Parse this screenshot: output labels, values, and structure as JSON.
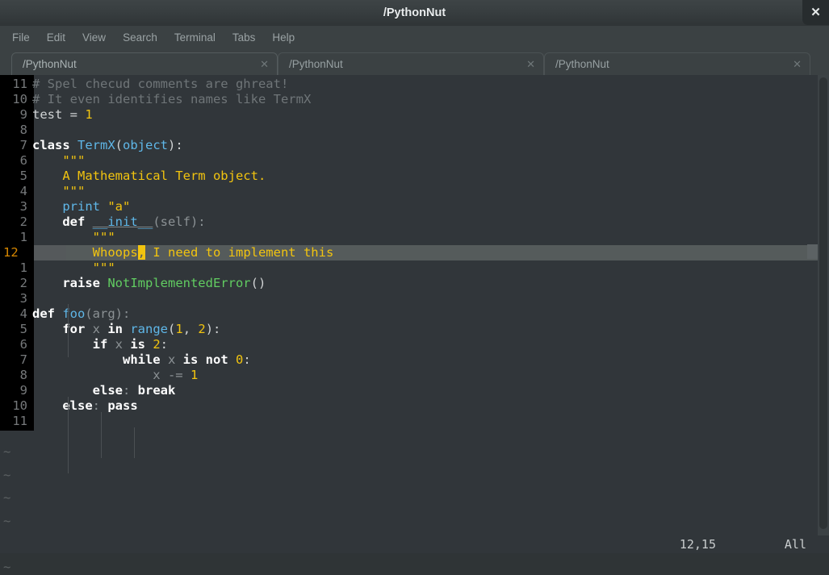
{
  "window": {
    "title": "/PythonNut",
    "close_label": "✕"
  },
  "menubar": {
    "items": [
      {
        "label": "File"
      },
      {
        "label": "Edit"
      },
      {
        "label": "View"
      },
      {
        "label": "Search"
      },
      {
        "label": "Terminal"
      },
      {
        "label": "Tabs"
      },
      {
        "label": "Help"
      }
    ]
  },
  "tabs": [
    {
      "label": "/PythonNut",
      "close": "✕",
      "active": true
    },
    {
      "label": "/PythonNut",
      "close": "✕",
      "active": false
    },
    {
      "label": "/PythonNut",
      "close": "✕",
      "active": false
    }
  ],
  "editor": {
    "cursor_position": "12,15",
    "scroll_indicator": "All",
    "current_line_number": "12",
    "lines": [
      {
        "num": "11",
        "segments": [
          {
            "t": "# Spel checud comments are ghreat!",
            "c": "c-comment"
          }
        ]
      },
      {
        "num": "10",
        "segments": [
          {
            "t": "# It even identifies names like TermX",
            "c": "c-comment"
          }
        ]
      },
      {
        "num": "9",
        "segments": [
          {
            "t": "test = ",
            "c": "c-plain"
          },
          {
            "t": "1",
            "c": "c-num"
          }
        ]
      },
      {
        "num": "8",
        "segments": []
      },
      {
        "num": "7",
        "segments": [
          {
            "t": "class ",
            "c": "c-kw"
          },
          {
            "t": "TermX",
            "c": "c-type"
          },
          {
            "t": "(",
            "c": "c-plain"
          },
          {
            "t": "object",
            "c": "c-type"
          },
          {
            "t": "):",
            "c": "c-plain"
          }
        ]
      },
      {
        "num": "6",
        "segments": [
          {
            "t": "    \"\"\"",
            "c": "c-str"
          }
        ]
      },
      {
        "num": "5",
        "segments": [
          {
            "t": "    A Mathematical Term object.",
            "c": "c-str"
          }
        ]
      },
      {
        "num": "4",
        "segments": [
          {
            "t": "    \"\"\"",
            "c": "c-str"
          }
        ]
      },
      {
        "num": "3",
        "segments": [
          {
            "t": "    ",
            "c": "c-plain"
          },
          {
            "t": "print ",
            "c": "c-func"
          },
          {
            "t": "\"a\"",
            "c": "c-str"
          }
        ]
      },
      {
        "num": "2",
        "segments": [
          {
            "t": "    ",
            "c": "c-plain"
          },
          {
            "t": "def ",
            "c": "c-kw"
          },
          {
            "t": "__init__",
            "c": "c-uline"
          },
          {
            "t": "(self):",
            "c": "c-dim"
          }
        ]
      },
      {
        "num": "1",
        "segments": [
          {
            "t": "        \"\"\"",
            "c": "c-str"
          }
        ]
      },
      {
        "num": "12",
        "current": true,
        "segments": [
          {
            "t": "        Whoops",
            "c": "c-curtext"
          },
          {
            "t": ",",
            "c": "cursorblk"
          },
          {
            "t": " I need to implement this",
            "c": "c-curtext"
          }
        ]
      },
      {
        "num": "1",
        "segments": [
          {
            "t": "        \"\"\"",
            "c": "c-str"
          }
        ]
      },
      {
        "num": "2",
        "segments": [
          {
            "t": "    ",
            "c": "c-plain"
          },
          {
            "t": "raise ",
            "c": "c-kw"
          },
          {
            "t": "NotImplementedError",
            "c": "c-green"
          },
          {
            "t": "()",
            "c": "c-plain"
          }
        ]
      },
      {
        "num": "3",
        "segments": []
      },
      {
        "num": "4",
        "segments": [
          {
            "t": "def ",
            "c": "c-kw"
          },
          {
            "t": "foo",
            "c": "c-func"
          },
          {
            "t": "(arg):",
            "c": "c-dim"
          }
        ]
      },
      {
        "num": "5",
        "segments": [
          {
            "t": "    ",
            "c": "c-plain"
          },
          {
            "t": "for ",
            "c": "c-kw"
          },
          {
            "t": "x ",
            "c": "c-dim"
          },
          {
            "t": "in ",
            "c": "c-kw"
          },
          {
            "t": "range",
            "c": "c-func"
          },
          {
            "t": "(",
            "c": "c-plain"
          },
          {
            "t": "1",
            "c": "c-num"
          },
          {
            "t": ", ",
            "c": "c-plain"
          },
          {
            "t": "2",
            "c": "c-num"
          },
          {
            "t": "):",
            "c": "c-plain"
          }
        ]
      },
      {
        "num": "6",
        "segments": [
          {
            "t": "        ",
            "c": "c-plain"
          },
          {
            "t": "if ",
            "c": "c-kw"
          },
          {
            "t": "x ",
            "c": "c-dim"
          },
          {
            "t": "is ",
            "c": "c-kw"
          },
          {
            "t": "2",
            "c": "c-num"
          },
          {
            "t": ":",
            "c": "c-plain"
          }
        ]
      },
      {
        "num": "7",
        "segments": [
          {
            "t": "            ",
            "c": "c-plain"
          },
          {
            "t": "while ",
            "c": "c-kw"
          },
          {
            "t": "x ",
            "c": "c-dim"
          },
          {
            "t": "is not ",
            "c": "c-kw"
          },
          {
            "t": "0",
            "c": "c-num"
          },
          {
            "t": ":",
            "c": "c-plain"
          }
        ]
      },
      {
        "num": "8",
        "segments": [
          {
            "t": "                x -= ",
            "c": "c-dim"
          },
          {
            "t": "1",
            "c": "c-num"
          }
        ]
      },
      {
        "num": "9",
        "segments": [
          {
            "t": "        ",
            "c": "c-plain"
          },
          {
            "t": "else",
            "c": "c-kw"
          },
          {
            "t": ": ",
            "c": "c-dim"
          },
          {
            "t": "break",
            "c": "c-kw"
          }
        ]
      },
      {
        "num": "10",
        "segments": [
          {
            "t": "    ",
            "c": "c-plain"
          },
          {
            "t": "else",
            "c": "c-kw"
          },
          {
            "t": ": ",
            "c": "c-dim"
          },
          {
            "t": "pass",
            "c": "c-kw"
          }
        ]
      },
      {
        "num": "11",
        "segments": []
      }
    ],
    "empty_markers": [
      "~",
      "~",
      "~",
      "~",
      "~",
      "~"
    ]
  },
  "colors": {
    "background": "#31363a",
    "gutter": "#000000",
    "current_line": "#555b5b",
    "current_lnum": "#d78700",
    "keyword": "#ffffff",
    "type": "#5fb7e8",
    "string": "#f2c40f",
    "comment": "#6f7578",
    "exception": "#61cc61",
    "cursor": "#f2c40f"
  }
}
